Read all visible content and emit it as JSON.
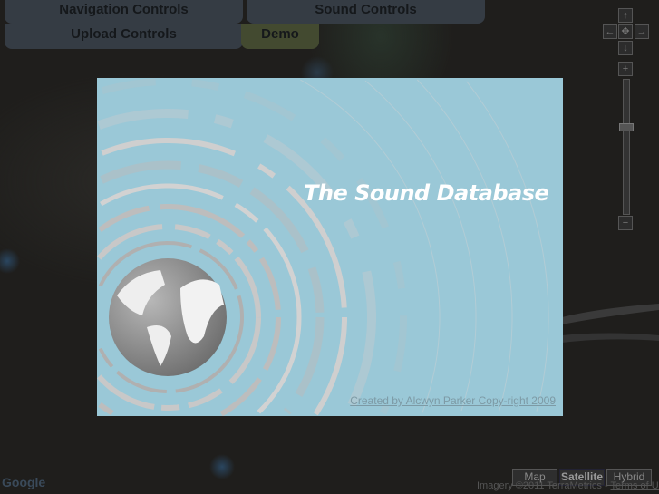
{
  "controls": {
    "navigation": "Navigation Controls",
    "sound": "Sound Controls",
    "upload": "Upload Controls",
    "demo": "Demo"
  },
  "pan": {
    "up": "↑",
    "left": "←",
    "center": "✥",
    "right": "→",
    "down": "↓"
  },
  "zoom": {
    "in": "+",
    "out": "−",
    "level_fraction": 0.35
  },
  "splash": {
    "title": "The Sound Database",
    "credit": "Created by Alcwyn Parker Copy-right 2009",
    "background": "#9ac8d7"
  },
  "map_types": [
    {
      "label": "Map"
    },
    {
      "label": "Satellite",
      "active": true
    },
    {
      "label": "Hybrid"
    }
  ],
  "attribution": {
    "imagery": "Imagery ©2011 TerraMetrics - ",
    "terms": "Terms of Use"
  },
  "logo": "Google"
}
